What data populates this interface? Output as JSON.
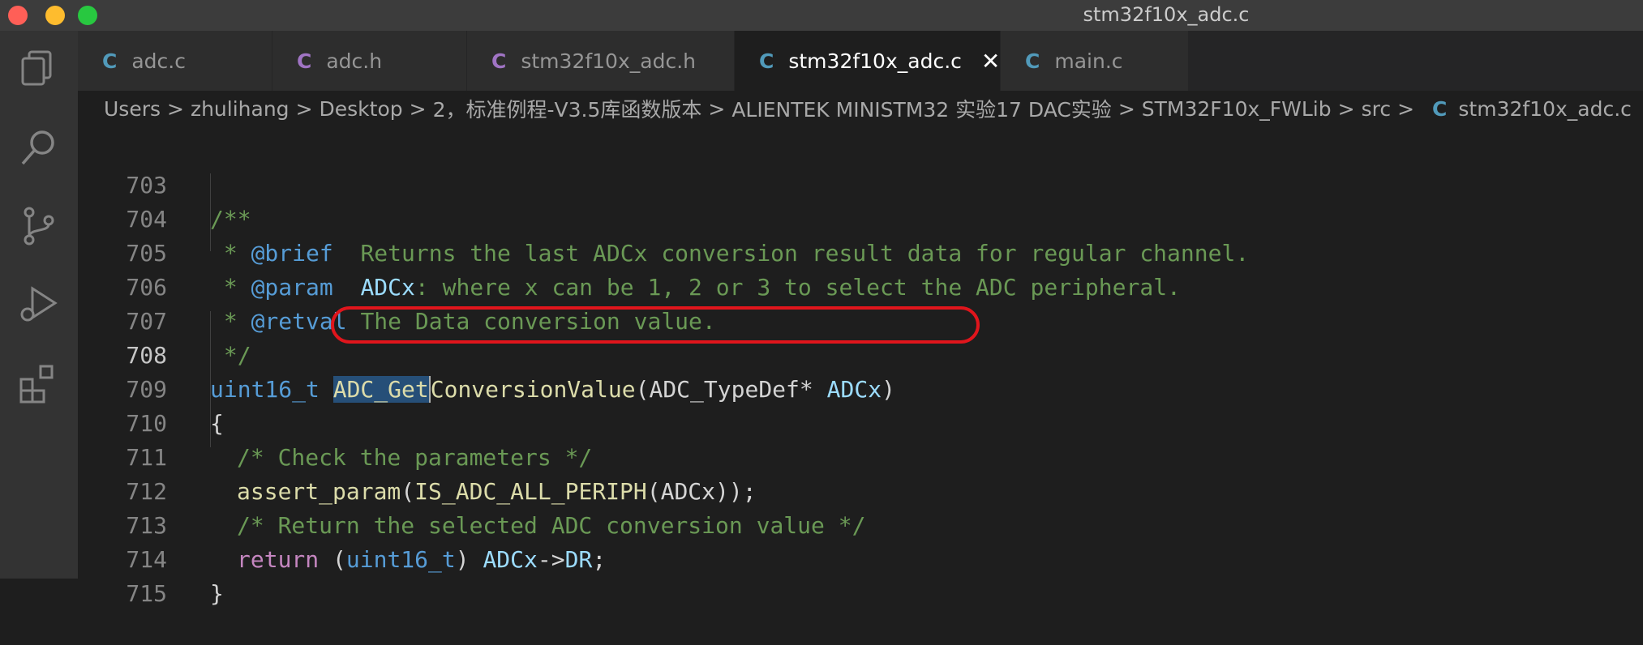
{
  "window": {
    "title": "stm32f10x_adc.c"
  },
  "activity_bar": {
    "items": [
      "explorer-icon",
      "search-icon",
      "source-control-icon",
      "run-debug-icon",
      "extensions-icon"
    ]
  },
  "tabs": [
    {
      "glyph": "C",
      "label": "adc.c",
      "glyph_color": "#519aba",
      "active": false
    },
    {
      "glyph": "C",
      "label": "adc.h",
      "glyph_color": "#a074c4",
      "active": false
    },
    {
      "glyph": "C",
      "label": "stm32f10x_adc.h",
      "glyph_color": "#a074c4",
      "active": false
    },
    {
      "glyph": "C",
      "label": "stm32f10x_adc.c",
      "glyph_color": "#519aba",
      "active": true,
      "close": "✕"
    },
    {
      "glyph": "C",
      "label": "main.c",
      "glyph_color": "#519aba",
      "active": false
    }
  ],
  "breadcrumb": {
    "items": [
      "Users",
      "zhulihang",
      "Desktop",
      "2，标准例程-V3.5库函数版本",
      "ALIENTEK MINISTM32 实验17 DAC实验",
      "STM32F10x_FWLib",
      "src"
    ],
    "file_glyph": "C",
    "file": "stm32f10x_adc.c",
    "separator": ">"
  },
  "editor": {
    "line_numbers": [
      "703",
      "704",
      "705",
      "706",
      "707",
      "708",
      "709",
      "710",
      "711",
      "712",
      "713",
      "714",
      "715"
    ],
    "current_line": "708",
    "code": {
      "l703": "/**",
      "l704_star": " * ",
      "l704_tag": "@brief",
      "l704_text": "  Returns the last ADCx conversion result data for regular channel.",
      "l705_star": " * ",
      "l705_tag": "@param",
      "l705_var": "  ADCx",
      "l705_text": ": where x can be 1, 2 or 3 to select the ADC peripheral.",
      "l706_star": " * ",
      "l706_tag": "@retval",
      "l706_text": " The Data conversion value.",
      "l707": " */",
      "l708_type": "uint16_t",
      "l708_fn_sel": "ADC_Get",
      "l708_fn_rest": "ConversionValue",
      "l708_open": "(",
      "l708_ptype": "ADC_TypeDef*",
      "l708_pname": "ADCx",
      "l708_close": ")",
      "l709": "{",
      "l710": "/* Check the parameters */",
      "l711_fn": "assert_param",
      "l711_open": "(",
      "l711_macro": "IS_ADC_ALL_PERIPH",
      "l711_args": "(ADCx));",
      "l712": "/* Return the selected ADC conversion value */",
      "l713_kw": "return",
      "l713_cast_open": " (",
      "l713_type": "uint16_t",
      "l713_cast_close": ") ",
      "l713_var": "ADCx",
      "l713_arrow": "->",
      "l713_member": "DR",
      "l713_semi": ";",
      "l714": "}"
    }
  },
  "annotation": {
    "color": "#e0151c"
  }
}
